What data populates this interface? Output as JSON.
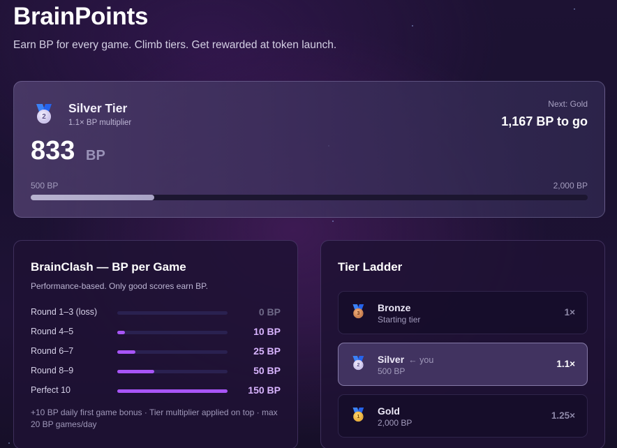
{
  "header": {
    "title": "BrainPoints",
    "subtitle": "Earn BP for every game. Climb tiers. Get rewarded at token launch."
  },
  "tier_card": {
    "medal_icon": "silver-medal-icon",
    "medal_number": "2",
    "tier_name": "Silver Tier",
    "multiplier": "1.1× BP multiplier",
    "next_label": "Next: Gold",
    "to_go": "1,167 BP to go",
    "bp_value": "833",
    "bp_unit": "BP",
    "range_min": "500 BP",
    "range_max": "2,000 BP",
    "progress_fraction": 0.222
  },
  "game_panel": {
    "title": "BrainClash — BP per Game",
    "subtitle": "Performance-based. Only good scores earn BP.",
    "rows": [
      {
        "label": "Round 1–3 (loss)",
        "value": "0 BP",
        "fraction": 0
      },
      {
        "label": "Round 4–5",
        "value": "10 BP",
        "fraction": 0.0667
      },
      {
        "label": "Round 6–7",
        "value": "25 BP",
        "fraction": 0.1667
      },
      {
        "label": "Round 8–9",
        "value": "50 BP",
        "fraction": 0.3333
      },
      {
        "label": "Perfect 10",
        "value": "150 BP",
        "fraction": 1
      }
    ],
    "footnote": "+10 BP daily first game bonus · Tier multiplier applied on top · max 20 BP games/day"
  },
  "ladder_panel": {
    "title": "Tier Ladder",
    "tiers": [
      {
        "name": "Bronze",
        "you": "",
        "sub": "Starting tier",
        "mult": "1×",
        "medal_number": "3",
        "medal_icon": "bronze-medal-icon"
      },
      {
        "name": "Silver",
        "you": "← you",
        "sub": "500 BP",
        "mult": "1.1×",
        "medal_number": "2",
        "medal_icon": "silver-medal-icon"
      },
      {
        "name": "Gold",
        "you": "",
        "sub": "2,000 BP",
        "mult": "1.25×",
        "medal_number": "1",
        "medal_icon": "gold-medal-icon"
      }
    ]
  },
  "colors": {
    "accent_purple": "#a855f7",
    "value_purple": "#d8b4fe",
    "progress_silver": "#b9b4d0",
    "medal_ribbon_blue": "#3b82f6"
  }
}
